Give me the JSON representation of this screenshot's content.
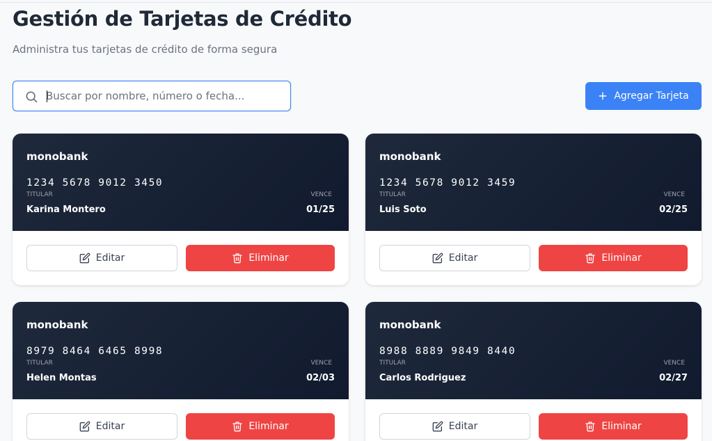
{
  "header": {
    "title": "Gestión de Tarjetas de Crédito",
    "subtitle": "Administra tus tarjetas de crédito de forma segura"
  },
  "search": {
    "placeholder": "Buscar por nombre, número o fecha...",
    "value": ""
  },
  "toolbar": {
    "add_label": "Agregar Tarjeta"
  },
  "labels": {
    "holder": "TITULAR",
    "expiry": "VENCE",
    "edit": "Editar",
    "delete": "Eliminar"
  },
  "cards": [
    {
      "bank": "monobank",
      "number": "1234 5678 9012 3450",
      "holder": "Karina Montero",
      "expiry": "01/25"
    },
    {
      "bank": "monobank",
      "number": "1234 5678 9012 3459",
      "holder": "Luis Soto",
      "expiry": "02/25"
    },
    {
      "bank": "monobank",
      "number": "8979 8464 6465 8998",
      "holder": "Helen Montas",
      "expiry": "02/03"
    },
    {
      "bank": "monobank",
      "number": "8988 8889 9849 8440",
      "holder": "Carlos Rodriguez",
      "expiry": "02/27"
    }
  ],
  "colors": {
    "accent": "#3b82f6",
    "danger": "#ef4444",
    "card_bg": "#1e293b"
  },
  "icons": {
    "search": "search-icon",
    "add": "plus-icon",
    "edit": "edit-icon",
    "delete": "trash-icon"
  }
}
